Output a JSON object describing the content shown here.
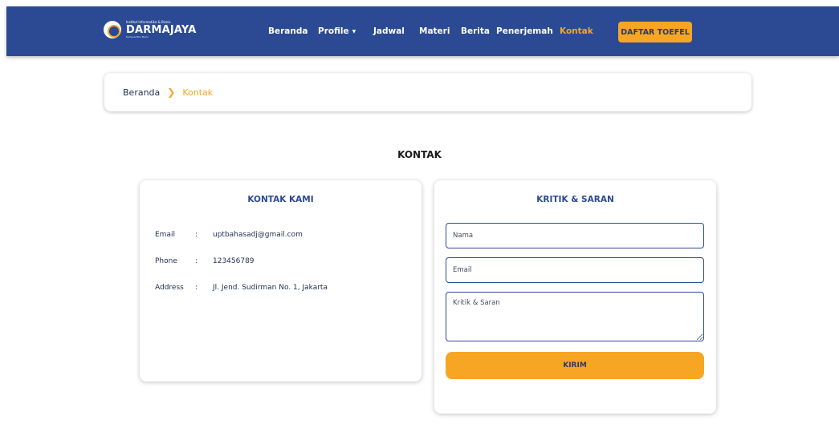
{
  "navbar": {
    "brand": {
      "small_text": "Institut Informatika & Bisnis",
      "name": "DARMAJAYA",
      "tagline": "Kampus Biru Bumi"
    },
    "items": [
      {
        "label": "Beranda"
      },
      {
        "label": "Profile"
      },
      {
        "label": "Jadwal"
      },
      {
        "label": "Materi"
      },
      {
        "label": "Berita"
      },
      {
        "label": "Penerjemah"
      },
      {
        "label": "Kontak",
        "active": true
      }
    ],
    "cta_label": "DAFTAR TOEFEL",
    "colors": {
      "background": "#2b4a93",
      "accent": "#f5a623"
    }
  },
  "breadcrumb": {
    "home": "Beranda",
    "separator_icon": "chevron-right-icon",
    "current": "Kontak"
  },
  "page_title": "KONTAK",
  "contact": {
    "title": "KONTAK KAMI",
    "rows": [
      {
        "label": "Email",
        "sep": ":",
        "value": "uptbahasadj@gmail.com"
      },
      {
        "label": "Phone",
        "sep": ":",
        "value": "123456789"
      },
      {
        "label": "Address",
        "sep": ":",
        "value": "Jl. Jend. Sudirman No. 1, Jakarta"
      }
    ]
  },
  "feedback": {
    "title": "KRITIK & SARAN",
    "name_placeholder": "Nama",
    "email_placeholder": "Email",
    "message_placeholder": "Kritik & Saran",
    "submit_label": "KIRIM"
  }
}
